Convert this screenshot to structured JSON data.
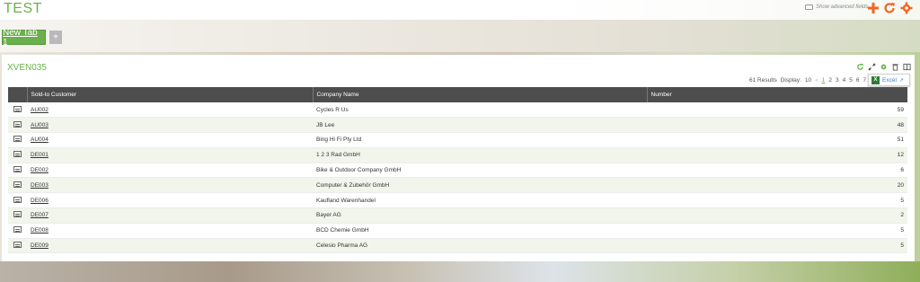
{
  "app": {
    "title": "TEST"
  },
  "topbar": {
    "advanced_toggle_label": "Show advanced fields",
    "icons": [
      "plus-icon",
      "refresh-icon",
      "gear-icon"
    ],
    "accent": "#f26522"
  },
  "tabs": [
    {
      "label": "New Tab 1",
      "active": true
    },
    {
      "label": "+",
      "active": false
    }
  ],
  "panel": {
    "title": "XVEN035",
    "results_text": "61 Results",
    "display_label": "Display:",
    "display_value": "10",
    "pages": [
      "1",
      "2",
      "3",
      "4",
      "5",
      "6",
      "7"
    ],
    "export_label": "Excel"
  },
  "table": {
    "columns": [
      "",
      "Sold-to Customer",
      "Company Name",
      "Number"
    ],
    "rows": [
      {
        "customer": "AU002",
        "company": "Cycles R Us",
        "number": "59"
      },
      {
        "customer": "AU003",
        "company": "JB Lee",
        "number": "48"
      },
      {
        "customer": "AU004",
        "company": "Bing Hi Fi Pty Ltd",
        "number": "51"
      },
      {
        "customer": "DE001",
        "company": "1 2 3 Rad GmbH",
        "number": "12"
      },
      {
        "customer": "DE002",
        "company": "Bike & Outdoor Company GmbH",
        "number": "6"
      },
      {
        "customer": "DE003",
        "company": "Computer & Zubehör GmbH",
        "number": "20"
      },
      {
        "customer": "DE006",
        "company": "Kaufland Warenhandel",
        "number": "5"
      },
      {
        "customer": "DE007",
        "company": "Bayer AG",
        "number": "2"
      },
      {
        "customer": "DE008",
        "company": "BCD Chemie GmbH",
        "number": "5"
      },
      {
        "customer": "DE009",
        "company": "Celesio Pharma AG",
        "number": "5"
      }
    ]
  },
  "colors": {
    "brand_green": "#6ab04c",
    "header_dark": "#4d4d4d"
  }
}
